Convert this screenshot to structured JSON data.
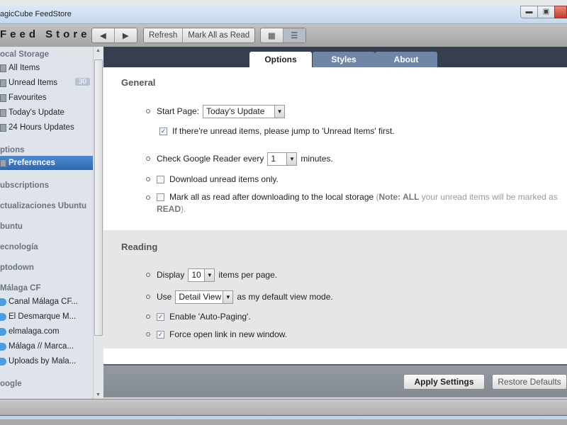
{
  "window": {
    "title": "agicCube FeedStore",
    "minimize_icon": "minimize-icon",
    "restore_icon": "restore-icon",
    "close_color": "#d9473b"
  },
  "toolbar": {
    "brand": "Feed Store",
    "back_icon": "triangle-left-icon",
    "forward_icon": "triangle-right-icon",
    "refresh": "Refresh",
    "mark_all_read": "Mark All as Read",
    "view_icons": [
      "detail-view-icon",
      "list-view-icon"
    ]
  },
  "sidebar": {
    "local_storage": "ocal Storage",
    "local_items": [
      {
        "label": "All Items"
      },
      {
        "label": "Unread Items",
        "badge": "30"
      },
      {
        "label": "Favourites"
      },
      {
        "label": "Today's Update"
      },
      {
        "label": "24 Hours Updates"
      }
    ],
    "options": "ptions",
    "preferences": "Preferences",
    "subscriptions": "ubscriptions",
    "groups": [
      "ctualizaciones Ubuntu",
      "buntu",
      "ecnología",
      "ptodown"
    ],
    "malaga": "Málaga CF",
    "feeds": [
      "Canal Málaga CF...",
      "El Desmarque M...",
      "elmalaga.com",
      "Málaga // Marca...",
      "Uploads by Mala..."
    ],
    "google": "oogle"
  },
  "tabs": [
    {
      "label": "Options",
      "active": true
    },
    {
      "label": "Styles"
    },
    {
      "label": "About"
    }
  ],
  "general": {
    "title": "General",
    "start_page_label": "Start Page:",
    "start_page_value": "Today's Update",
    "jump_unread": {
      "label": "If there're unread items, please jump to 'Unread Items' first.",
      "checked": true
    },
    "check_pre": "Check Google Reader every",
    "check_value": "1",
    "check_post": "minutes.",
    "download_unread": {
      "label": "Download unread items only.",
      "checked": false
    },
    "mark_all": {
      "label": "Mark all as read after downloading to the local storage",
      "note_open": " (",
      "note_b1": "Note: ALL",
      "note_mid": " your unread items will be marked as",
      "note_b2": "READ",
      "note_close": ").",
      "checked": false
    }
  },
  "reading": {
    "title": "Reading",
    "display_pre": "Display",
    "display_value": "10",
    "display_post": "items per page.",
    "use_pre": "Use",
    "use_value": "Detail View",
    "use_post": "as my default view mode.",
    "auto_paging": {
      "label": "Enable 'Auto-Paging'.",
      "checked": true
    },
    "force_open": {
      "label": "Force open link in new window.",
      "checked": true
    }
  },
  "footer": {
    "apply": "Apply Settings",
    "restore": "Restore Defaults"
  }
}
